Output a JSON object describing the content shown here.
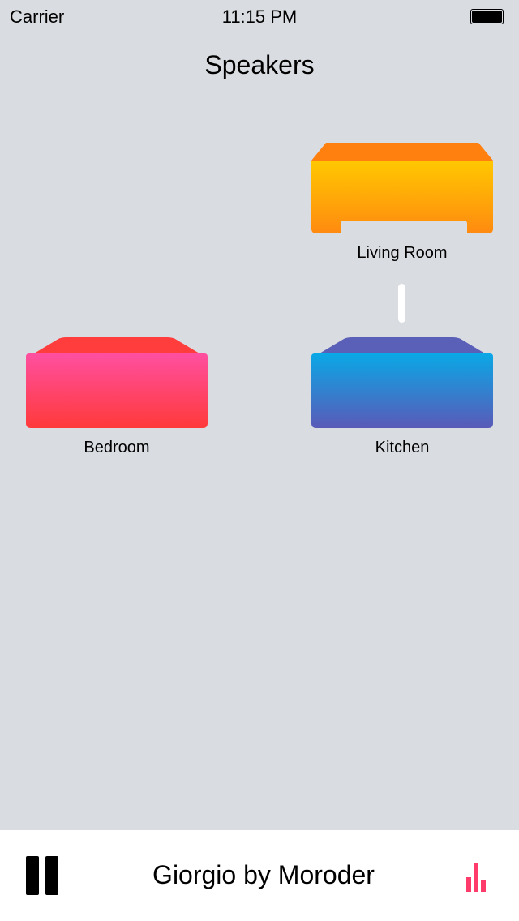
{
  "status_bar": {
    "carrier": "Carrier",
    "time": "11:15 PM",
    "battery_icon": "battery-full-icon"
  },
  "nav": {
    "title": "Speakers"
  },
  "speakers": {
    "living_room": {
      "name": "Living Room",
      "colors": {
        "top": "#ff7f0f",
        "front_start": "#ffc800",
        "front_end": "#ff8a10"
      },
      "linked": true
    },
    "bedroom": {
      "name": "Bedroom",
      "colors": {
        "top": "#ff3d3d",
        "front_start": "#ff4fa0",
        "front_end": "#ff3a3a"
      }
    },
    "kitchen": {
      "name": "Kitchen",
      "colors": {
        "top": "#5a5fb8",
        "front_start": "#0aa8e6",
        "front_end": "#5a5ab8"
      },
      "linked": true
    }
  },
  "now_playing": {
    "title": "Giorgio by Moroder",
    "state_icon": "pause-icon",
    "visualizer_icon": "equalizer-icon",
    "accent_color": "#ff3b6b"
  }
}
